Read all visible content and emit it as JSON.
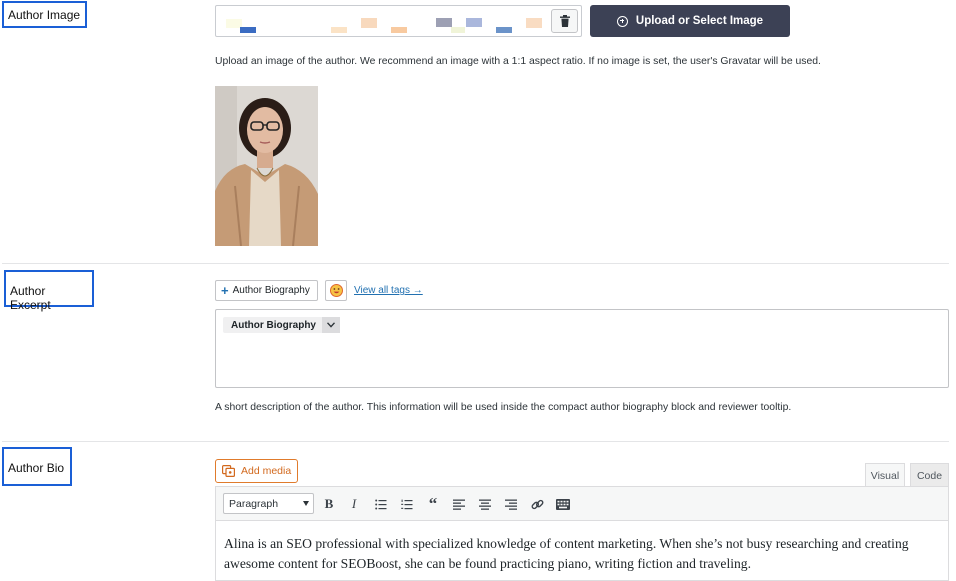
{
  "author_image": {
    "label": "Author Image",
    "upload_button_label": "Upload or Select Image",
    "help_text": "Upload an image of the author. We recommend an image with a 1:1 aspect ratio. If no image is set, the user's Gravatar will be used.",
    "icons": {
      "trash": "trash-icon",
      "upload": "plus-circle-icon"
    }
  },
  "author_excerpt": {
    "label": "Author Excerpt",
    "tag_button_label": "Author Biography",
    "view_all_tags_link": "View all tags →",
    "chip_label": "Author Biography",
    "help_text": "A short description of the author. This information will be used inside the compact author biography block and reviewer tooltip.",
    "icons": {
      "emoji": "emoji-icon",
      "caret": "chevron-down-icon"
    }
  },
  "author_bio": {
    "label": "Author Bio",
    "add_media_label": "Add media",
    "tabs": {
      "visual": "Visual",
      "code": "Code"
    },
    "format_select_value": "Paragraph",
    "toolbar_icons": [
      "bold-icon",
      "italic-icon",
      "bullet-list-icon",
      "numbered-list-icon",
      "blockquote-icon",
      "align-left-icon",
      "align-center-icon",
      "align-right-icon",
      "link-icon",
      "toolbar-toggle-icon"
    ],
    "content": "Alina is an SEO professional with specialized knowledge of content marketing. When she’s not busy researching and creating awesome content for SEOBoost, she can be found practicing piano, writing fiction and traveling."
  },
  "colors": {
    "label_border": "#1a5fd6",
    "upload_button_bg": "#3c4155",
    "link": "#2271b1",
    "add_media_accent": "#e07b2c"
  }
}
